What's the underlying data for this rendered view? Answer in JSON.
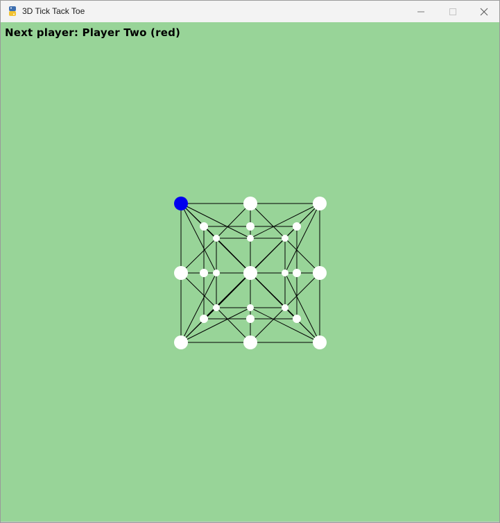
{
  "window": {
    "title": "3D Tick Tack Toe",
    "app_icon": "python-icon",
    "controls": {
      "minimize_icon": "minimize-icon",
      "maximize_icon": "maximize-icon",
      "close_icon": "close-icon"
    }
  },
  "game": {
    "status_text": "Next player: Player Two (red)",
    "background_color": "#98d498",
    "empty_color": "#ffffff",
    "player_one_color": "#0000ee",
    "player_two_color": "#ff0000",
    "line_color": "#000000",
    "layers": [
      {
        "layer": "outer",
        "cells": [
          "blue",
          "empty",
          "empty",
          "empty",
          "empty",
          "empty",
          "empty",
          "empty",
          "empty"
        ]
      },
      {
        "layer": "middle",
        "cells": [
          "empty",
          "empty",
          "empty",
          "empty",
          "empty",
          "empty",
          "empty",
          "empty",
          "empty"
        ]
      },
      {
        "layer": "inner",
        "cells": [
          "empty",
          "empty",
          "empty",
          "empty",
          "empty",
          "empty",
          "empty",
          "empty",
          "empty"
        ]
      }
    ]
  }
}
